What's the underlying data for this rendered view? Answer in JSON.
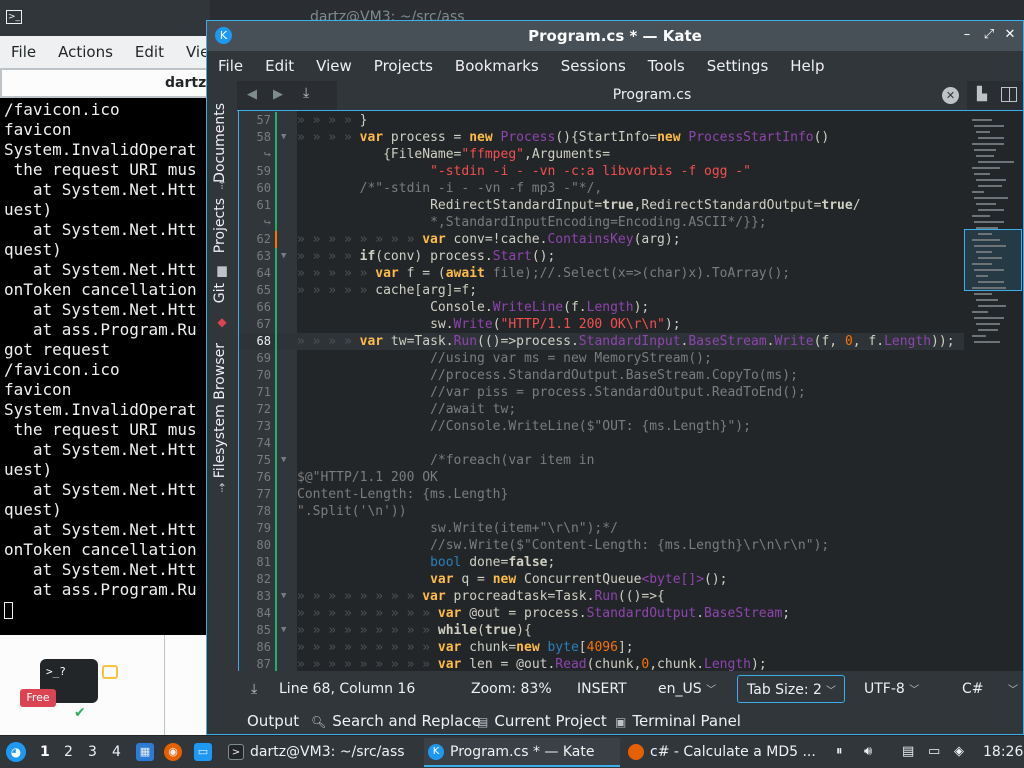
{
  "konsole": {
    "title": "dartz@VM3: ~/src/ass",
    "menu": [
      "File",
      "Actions",
      "Edit",
      "View"
    ],
    "tab_label": "dartz",
    "lines": [
      "/favicon.ico",
      "favicon",
      "System.InvalidOperat",
      " the request URI mus",
      "   at System.Net.Htt",
      "uest)",
      "   at System.Net.Htt",
      "quest)",
      "   at System.Net.Htt",
      "onToken cancellation",
      "   at System.Net.Htt",
      "   at ass.Program.Ru",
      "got request",
      "/favicon.ico",
      "favicon",
      "System.InvalidOperat",
      " the request URI mus",
      "   at System.Net.Htt",
      "uest)",
      "   at System.Net.Htt",
      "quest)",
      "   at System.Net.Htt",
      "onToken cancellation",
      "   at System.Net.Htt",
      "   at ass.Program.Ru"
    ]
  },
  "promo": {
    "prompt": ">_?",
    "badge": "Free"
  },
  "kate": {
    "title": "Program.cs * — Kate",
    "menu": [
      "File",
      "Edit",
      "View",
      "Projects",
      "Bookmarks",
      "Sessions",
      "Tools",
      "Settings",
      "Help"
    ],
    "sidebar_tabs": [
      "Documents",
      "Projects",
      "Git",
      "Filesystem Browser"
    ],
    "tab": "Program.cs",
    "code_lines": [
      {
        "n": "57",
        "wrap": false
      },
      {
        "n": "58",
        "wrap": false
      },
      {
        "n": "↪",
        "wrap": true
      },
      {
        "n": "59",
        "wrap": false
      },
      {
        "n": "60",
        "wrap": false
      },
      {
        "n": "61",
        "wrap": false
      },
      {
        "n": "↪",
        "wrap": true
      },
      {
        "n": "62",
        "wrap": false
      },
      {
        "n": "63",
        "wrap": false
      },
      {
        "n": "64",
        "wrap": false
      },
      {
        "n": "65",
        "wrap": false
      },
      {
        "n": "66",
        "wrap": false
      },
      {
        "n": "67",
        "wrap": false
      },
      {
        "n": "68",
        "wrap": false
      },
      {
        "n": "69",
        "wrap": false
      },
      {
        "n": "70",
        "wrap": false
      },
      {
        "n": "71",
        "wrap": false
      },
      {
        "n": "72",
        "wrap": false
      },
      {
        "n": "73",
        "wrap": false
      },
      {
        "n": "74",
        "wrap": false
      },
      {
        "n": "75",
        "wrap": false
      },
      {
        "n": "76",
        "wrap": false
      },
      {
        "n": "77",
        "wrap": false
      },
      {
        "n": "78",
        "wrap": false
      },
      {
        "n": "79",
        "wrap": false
      },
      {
        "n": "80",
        "wrap": false
      },
      {
        "n": "81",
        "wrap": false
      },
      {
        "n": "82",
        "wrap": false
      },
      {
        "n": "83",
        "wrap": false
      },
      {
        "n": "84",
        "wrap": false
      },
      {
        "n": "85",
        "wrap": false
      },
      {
        "n": "86",
        "wrap": false
      },
      {
        "n": "87",
        "wrap": false
      }
    ],
    "code": {
      "l57": "}",
      "l58a": "var",
      "l58b": " process = ",
      "l58c": "new",
      "l58d": "Process",
      "l58e": "(){StartInfo=",
      "l58f": "new",
      "l58g": "ProcessStartInfo",
      "l58h": "()",
      "l58w1": "{FileName=",
      "l58w2": "\"ffmpeg\"",
      "l58w3": ",Arguments=",
      "l59": "\"-stdin -i - -vn -c:a libvorbis -f ogg -\"",
      "l60": "/*\"-stdin -i - -vn -f mp3 -\"*/,",
      "l61a": "RedirectStandardInput=",
      "l61b": "true",
      "l61c": ",RedirectStandardOutput=",
      "l61d": "true",
      "l61e": "/",
      "l61w": "*,StandardInputEncoding=Encoding.ASCII*/}};",
      "l62a": "var",
      "l62b": " conv=!cache.",
      "l62c": "ContainsKey",
      "l62d": "(arg);",
      "l63a": "if",
      "l63b": "(conv) process.",
      "l63c": "Start",
      "l63d": "();",
      "l64a": "var",
      "l64b": " f = (",
      "l64c": "await",
      "l64d": " file);//.Select(x=>(char)x).ToArray();",
      "l65": "cache[arg]=f;",
      "l66a": "Console.",
      "l66b": "WriteLine",
      "l66c": "(f.",
      "l66d": "Length",
      "l66e": ");",
      "l67a": "sw.",
      "l67b": "Write",
      "l67c": "(",
      "l67d": "\"HTTP/1.1 200 OK\\r\\n\"",
      "l67e": ");",
      "l68a": "var",
      "l68b": " tw=Task.",
      "l68c": "Run",
      "l68d": "(()=>process.",
      "l68e": "StandardInput",
      "l68f": ".",
      "l68g": "BaseStream",
      "l68h": ".",
      "l68i": "Write",
      "l68j": "(f, ",
      "l68k": "0",
      "l68l": ", f.",
      "l68m": "Length",
      "l68n": "));",
      "l69": "//using var ms = new MemoryStream();",
      "l70": "//process.StandardOutput.BaseStream.CopyTo(ms);",
      "l71": "//var piss = process.StandardOutput.ReadToEnd();",
      "l72": "//await tw;",
      "l73": "//Console.WriteLine($\"OUT: {ms.Length}\");",
      "l75": "/*foreach(var item in",
      "l76": "$@\"HTTP/1.1 200 OK",
      "l77": "Content-Length: {ms.Length}",
      "l78": "\".Split('\\n'))",
      "l79": "sw.Write(item+\"\\r\\n\");*/",
      "l80": "//sw.Write($\"Content-Length: {ms.Length}\\r\\n\\r\\n\");",
      "l81a": "bool",
      "l81b": " done=",
      "l81c": "false",
      "l81d": ";",
      "l82a": "var",
      "l82b": " q = ",
      "l82c": "new",
      "l82d": " ConcurrentQueue",
      "l82e": "<byte[]>",
      "l82f": "();",
      "l83a": "var",
      "l83b": " procreadtask=Task.",
      "l83c": "Run",
      "l83d": "(()=>{",
      "l84a": "var",
      "l84b": " @out = process.",
      "l84c": "StandardOutput",
      "l84d": ".",
      "l84e": "BaseStream",
      "l84f": ";",
      "l85a": "while",
      "l85b": "(",
      "l85c": "true",
      "l85d": "){",
      "l86a": "var",
      "l86b": " chunk=",
      "l86c": "new",
      "l86d": " byte",
      "l86e": "[",
      "l86f": "4096",
      "l86g": "];",
      "l87a": "var",
      "l87b": " len = @out.",
      "l87c": "Read",
      "l87d": "(chunk,",
      "l87e": "0",
      "l87f": ",chunk.",
      "l87g": "Length",
      "l87h": ");"
    },
    "status": {
      "position": "Line 68, Column 16",
      "zoom": "Zoom: 83%",
      "mode": "INSERT",
      "dictionary": "en_US",
      "tab_size": "Tab Size: 2",
      "encoding": "UTF-8",
      "language": "C#"
    },
    "tool_panels": [
      "Output",
      "Search and Replace",
      "Current Project",
      "Terminal Panel"
    ]
  },
  "taskbar": {
    "desktops": [
      "1",
      "2",
      "3",
      "4"
    ],
    "tasks": [
      {
        "label": "dartz@VM3: ~/src/ass"
      },
      {
        "label": "Program.cs * — Kate"
      },
      {
        "label": "c# - Calculate a MD5 ..."
      }
    ],
    "clock": "18:26"
  }
}
